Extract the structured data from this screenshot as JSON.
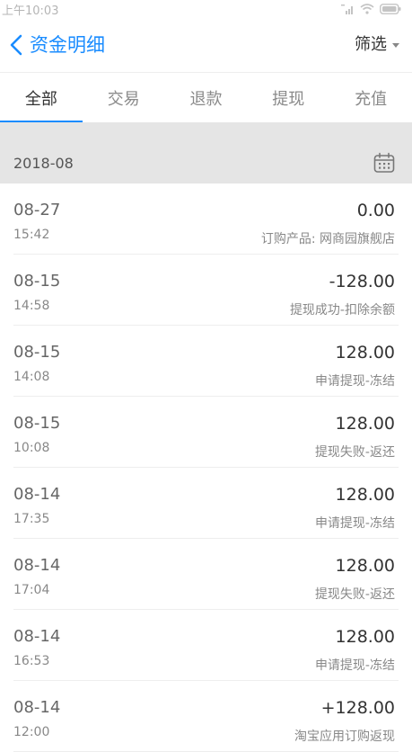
{
  "status_bar": {
    "time": "上午10:03"
  },
  "nav": {
    "title": "资金明细",
    "filter_label": "筛选"
  },
  "tabs": [
    {
      "label": "全部",
      "active": true
    },
    {
      "label": "交易",
      "active": false
    },
    {
      "label": "退款",
      "active": false
    },
    {
      "label": "提现",
      "active": false
    },
    {
      "label": "充值",
      "active": false
    }
  ],
  "month_header": {
    "label": "2018-08"
  },
  "transactions": [
    {
      "date": "08-27",
      "time": "15:42",
      "amount": "0.00",
      "desc": "订购产品: 网商园旗舰店"
    },
    {
      "date": "08-15",
      "time": "14:58",
      "amount": "-128.00",
      "desc": "提现成功-扣除余额"
    },
    {
      "date": "08-15",
      "time": "14:08",
      "amount": "128.00",
      "desc": "申请提现-冻结"
    },
    {
      "date": "08-15",
      "time": "10:08",
      "amount": "128.00",
      "desc": "提现失败-返还"
    },
    {
      "date": "08-14",
      "time": "17:35",
      "amount": "128.00",
      "desc": "申请提现-冻结"
    },
    {
      "date": "08-14",
      "time": "17:04",
      "amount": "128.00",
      "desc": "提现失败-返还"
    },
    {
      "date": "08-14",
      "time": "16:53",
      "amount": "128.00",
      "desc": "申请提现-冻结"
    },
    {
      "date": "08-14",
      "time": "12:00",
      "amount": "+128.00",
      "desc": "淘宝应用订购返现"
    }
  ],
  "colors": {
    "accent": "#1a8cff",
    "band": "#e5e5e5",
    "divider": "#eeeeee"
  }
}
